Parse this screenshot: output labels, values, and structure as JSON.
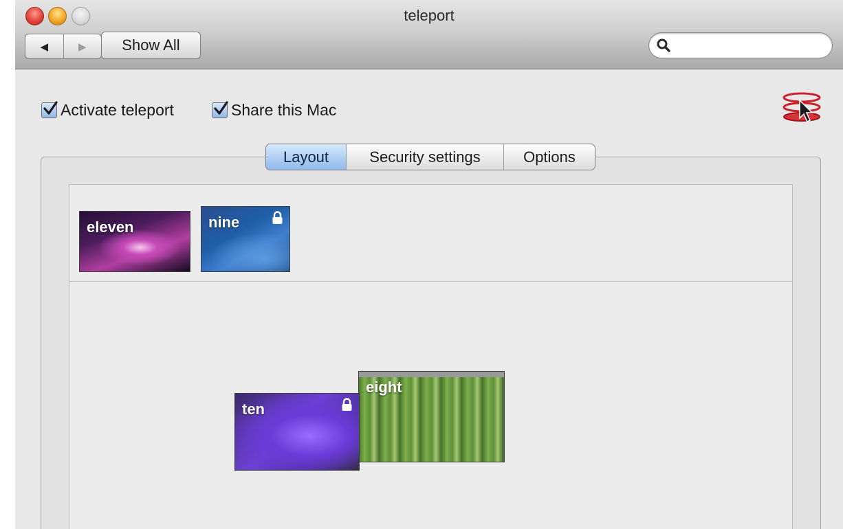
{
  "window": {
    "title": "teleport"
  },
  "toolbar": {
    "back_glyph": "◀",
    "forward_glyph": "▶",
    "show_all_label": "Show All",
    "search_value": "",
    "search_icon": "search-icon"
  },
  "options": {
    "activate_label": "Activate teleport",
    "activate_checked": true,
    "share_label": "Share this Mac",
    "share_checked": true
  },
  "tabs": [
    {
      "label": "Layout",
      "active": true
    },
    {
      "label": "Security settings",
      "active": false
    },
    {
      "label": "Options",
      "active": false
    }
  ],
  "layout": {
    "unplaced_screens": [
      {
        "name": "eleven",
        "locked": false
      },
      {
        "name": "nine",
        "locked": true
      }
    ],
    "placed_screens": [
      {
        "name": "ten",
        "locked": true
      },
      {
        "name": "eight",
        "locked": false
      }
    ]
  },
  "colors": {
    "selection_blue": "#8fb9ec",
    "close_red": "#e0443a",
    "minimize_yellow": "#f3a62a"
  }
}
